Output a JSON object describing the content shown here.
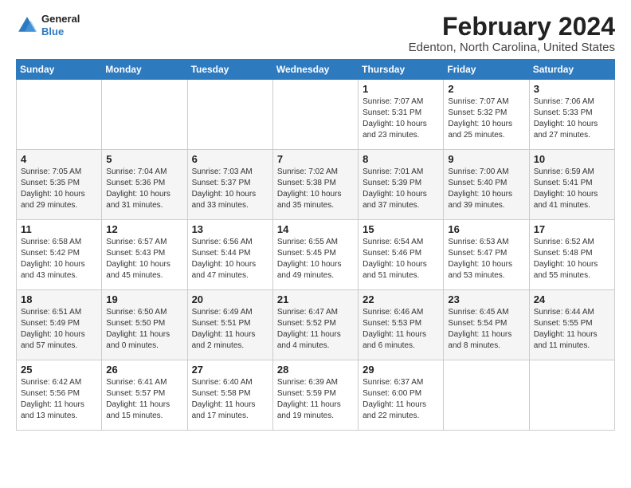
{
  "app": {
    "logo_line1": "General",
    "logo_line2": "Blue"
  },
  "header": {
    "title": "February 2024",
    "subtitle": "Edenton, North Carolina, United States"
  },
  "days_of_week": [
    "Sunday",
    "Monday",
    "Tuesday",
    "Wednesday",
    "Thursday",
    "Friday",
    "Saturday"
  ],
  "weeks": [
    [
      {
        "num": "",
        "detail": ""
      },
      {
        "num": "",
        "detail": ""
      },
      {
        "num": "",
        "detail": ""
      },
      {
        "num": "",
        "detail": ""
      },
      {
        "num": "1",
        "detail": "Sunrise: 7:07 AM\nSunset: 5:31 PM\nDaylight: 10 hours\nand 23 minutes."
      },
      {
        "num": "2",
        "detail": "Sunrise: 7:07 AM\nSunset: 5:32 PM\nDaylight: 10 hours\nand 25 minutes."
      },
      {
        "num": "3",
        "detail": "Sunrise: 7:06 AM\nSunset: 5:33 PM\nDaylight: 10 hours\nand 27 minutes."
      }
    ],
    [
      {
        "num": "4",
        "detail": "Sunrise: 7:05 AM\nSunset: 5:35 PM\nDaylight: 10 hours\nand 29 minutes."
      },
      {
        "num": "5",
        "detail": "Sunrise: 7:04 AM\nSunset: 5:36 PM\nDaylight: 10 hours\nand 31 minutes."
      },
      {
        "num": "6",
        "detail": "Sunrise: 7:03 AM\nSunset: 5:37 PM\nDaylight: 10 hours\nand 33 minutes."
      },
      {
        "num": "7",
        "detail": "Sunrise: 7:02 AM\nSunset: 5:38 PM\nDaylight: 10 hours\nand 35 minutes."
      },
      {
        "num": "8",
        "detail": "Sunrise: 7:01 AM\nSunset: 5:39 PM\nDaylight: 10 hours\nand 37 minutes."
      },
      {
        "num": "9",
        "detail": "Sunrise: 7:00 AM\nSunset: 5:40 PM\nDaylight: 10 hours\nand 39 minutes."
      },
      {
        "num": "10",
        "detail": "Sunrise: 6:59 AM\nSunset: 5:41 PM\nDaylight: 10 hours\nand 41 minutes."
      }
    ],
    [
      {
        "num": "11",
        "detail": "Sunrise: 6:58 AM\nSunset: 5:42 PM\nDaylight: 10 hours\nand 43 minutes."
      },
      {
        "num": "12",
        "detail": "Sunrise: 6:57 AM\nSunset: 5:43 PM\nDaylight: 10 hours\nand 45 minutes."
      },
      {
        "num": "13",
        "detail": "Sunrise: 6:56 AM\nSunset: 5:44 PM\nDaylight: 10 hours\nand 47 minutes."
      },
      {
        "num": "14",
        "detail": "Sunrise: 6:55 AM\nSunset: 5:45 PM\nDaylight: 10 hours\nand 49 minutes."
      },
      {
        "num": "15",
        "detail": "Sunrise: 6:54 AM\nSunset: 5:46 PM\nDaylight: 10 hours\nand 51 minutes."
      },
      {
        "num": "16",
        "detail": "Sunrise: 6:53 AM\nSunset: 5:47 PM\nDaylight: 10 hours\nand 53 minutes."
      },
      {
        "num": "17",
        "detail": "Sunrise: 6:52 AM\nSunset: 5:48 PM\nDaylight: 10 hours\nand 55 minutes."
      }
    ],
    [
      {
        "num": "18",
        "detail": "Sunrise: 6:51 AM\nSunset: 5:49 PM\nDaylight: 10 hours\nand 57 minutes."
      },
      {
        "num": "19",
        "detail": "Sunrise: 6:50 AM\nSunset: 5:50 PM\nDaylight: 11 hours\nand 0 minutes."
      },
      {
        "num": "20",
        "detail": "Sunrise: 6:49 AM\nSunset: 5:51 PM\nDaylight: 11 hours\nand 2 minutes."
      },
      {
        "num": "21",
        "detail": "Sunrise: 6:47 AM\nSunset: 5:52 PM\nDaylight: 11 hours\nand 4 minutes."
      },
      {
        "num": "22",
        "detail": "Sunrise: 6:46 AM\nSunset: 5:53 PM\nDaylight: 11 hours\nand 6 minutes."
      },
      {
        "num": "23",
        "detail": "Sunrise: 6:45 AM\nSunset: 5:54 PM\nDaylight: 11 hours\nand 8 minutes."
      },
      {
        "num": "24",
        "detail": "Sunrise: 6:44 AM\nSunset: 5:55 PM\nDaylight: 11 hours\nand 11 minutes."
      }
    ],
    [
      {
        "num": "25",
        "detail": "Sunrise: 6:42 AM\nSunset: 5:56 PM\nDaylight: 11 hours\nand 13 minutes."
      },
      {
        "num": "26",
        "detail": "Sunrise: 6:41 AM\nSunset: 5:57 PM\nDaylight: 11 hours\nand 15 minutes."
      },
      {
        "num": "27",
        "detail": "Sunrise: 6:40 AM\nSunset: 5:58 PM\nDaylight: 11 hours\nand 17 minutes."
      },
      {
        "num": "28",
        "detail": "Sunrise: 6:39 AM\nSunset: 5:59 PM\nDaylight: 11 hours\nand 19 minutes."
      },
      {
        "num": "29",
        "detail": "Sunrise: 6:37 AM\nSunset: 6:00 PM\nDaylight: 11 hours\nand 22 minutes."
      },
      {
        "num": "",
        "detail": ""
      },
      {
        "num": "",
        "detail": ""
      }
    ]
  ]
}
